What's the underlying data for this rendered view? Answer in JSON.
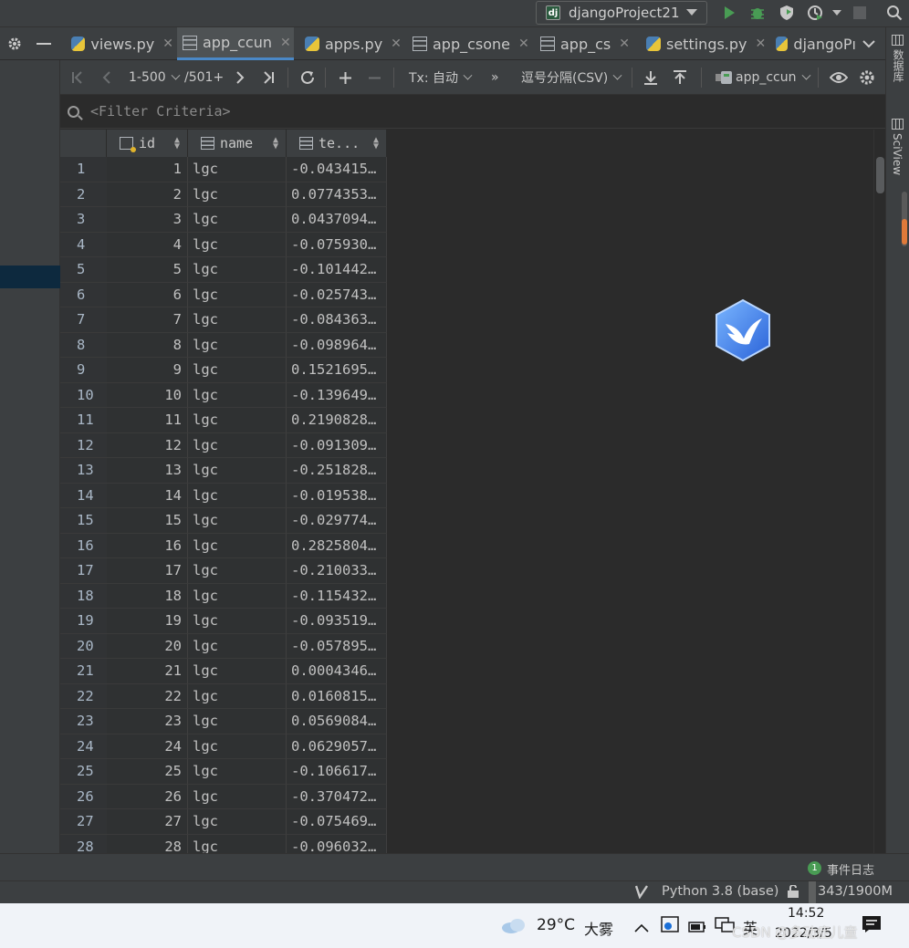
{
  "runbar": {
    "project_badge": "dj",
    "project_label": "djangoProject21"
  },
  "tabs": [
    {
      "label": "views.py",
      "icon": "python-file-icon",
      "active": false
    },
    {
      "label": "app_ccun",
      "icon": "table-icon",
      "active": true
    },
    {
      "label": "apps.py",
      "icon": "python-file-icon",
      "active": false
    },
    {
      "label": "app_csone",
      "icon": "table-icon",
      "active": false
    },
    {
      "label": "app_cs",
      "icon": "table-icon",
      "active": false
    },
    {
      "label": "settings.py",
      "icon": "python-file-icon",
      "active": false
    },
    {
      "label": "djangoPı",
      "icon": "python-file-icon",
      "active": false
    }
  ],
  "toolbar": {
    "page_range": "1-500",
    "total": "/501+",
    "tx_mode": "Tx: 自动",
    "more": "»",
    "export_format": "逗号分隔(CSV)",
    "datasource": "app_ccun"
  },
  "filter": {
    "placeholder": "<Filter Criteria>"
  },
  "table": {
    "columns": [
      {
        "label": "id",
        "icon": "primary-key-column-icon"
      },
      {
        "label": "name",
        "icon": "column-icon"
      },
      {
        "label": "te...",
        "icon": "column-icon"
      }
    ],
    "rows": [
      {
        "n": "1",
        "id": "1",
        "name": "lgc",
        "te": "-0.043415…"
      },
      {
        "n": "2",
        "id": "2",
        "name": "lgc",
        "te": "0.0774353…"
      },
      {
        "n": "3",
        "id": "3",
        "name": "lgc",
        "te": "0.0437094…"
      },
      {
        "n": "4",
        "id": "4",
        "name": "lgc",
        "te": "-0.075930…"
      },
      {
        "n": "5",
        "id": "5",
        "name": "lgc",
        "te": "-0.101442…"
      },
      {
        "n": "6",
        "id": "6",
        "name": "lgc",
        "te": "-0.025743…"
      },
      {
        "n": "7",
        "id": "7",
        "name": "lgc",
        "te": "-0.084363…"
      },
      {
        "n": "8",
        "id": "8",
        "name": "lgc",
        "te": "-0.098964…"
      },
      {
        "n": "9",
        "id": "9",
        "name": "lgc",
        "te": "0.1521695…"
      },
      {
        "n": "10",
        "id": "10",
        "name": "lgc",
        "te": "-0.139649…"
      },
      {
        "n": "11",
        "id": "11",
        "name": "lgc",
        "te": "0.2190828…"
      },
      {
        "n": "12",
        "id": "12",
        "name": "lgc",
        "te": "-0.091309…"
      },
      {
        "n": "13",
        "id": "13",
        "name": "lgc",
        "te": "-0.251828…"
      },
      {
        "n": "14",
        "id": "14",
        "name": "lgc",
        "te": "-0.019538…"
      },
      {
        "n": "15",
        "id": "15",
        "name": "lgc",
        "te": "-0.029774…"
      },
      {
        "n": "16",
        "id": "16",
        "name": "lgc",
        "te": "0.2825804…"
      },
      {
        "n": "17",
        "id": "17",
        "name": "lgc",
        "te": "-0.210033…"
      },
      {
        "n": "18",
        "id": "18",
        "name": "lgc",
        "te": "-0.115432…"
      },
      {
        "n": "19",
        "id": "19",
        "name": "lgc",
        "te": "-0.093519…"
      },
      {
        "n": "20",
        "id": "20",
        "name": "lgc",
        "te": "-0.057895…"
      },
      {
        "n": "21",
        "id": "21",
        "name": "lgc",
        "te": "0.0004346…"
      },
      {
        "n": "22",
        "id": "22",
        "name": "lgc",
        "te": "0.0160815…"
      },
      {
        "n": "23",
        "id": "23",
        "name": "lgc",
        "te": "0.0569084…"
      },
      {
        "n": "24",
        "id": "24",
        "name": "lgc",
        "te": "0.0629057…"
      },
      {
        "n": "25",
        "id": "25",
        "name": "lgc",
        "te": "-0.106617…"
      },
      {
        "n": "26",
        "id": "26",
        "name": "lgc",
        "te": "-0.370472…"
      },
      {
        "n": "27",
        "id": "27",
        "name": "lgc",
        "te": "-0.075469…"
      },
      {
        "n": "28",
        "id": "28",
        "name": "lgc",
        "te": "-0.096032…"
      }
    ]
  },
  "right_sidebar": {
    "database_label": "数据库",
    "sciview_label": "SciView"
  },
  "event_log": {
    "count": "1",
    "label": "事件日志"
  },
  "statusbar": {
    "interpreter": "Python 3.8 (base)",
    "memory": "343/1900M"
  },
  "taskbar": {
    "temperature": "29°C",
    "weather": "大雾",
    "ime": "英",
    "time": "14:52",
    "date": "2022/3/5",
    "watermark": "CSDN @多动症儿童"
  },
  "colors": {
    "accent": "#4a88c7",
    "editor_bg": "#2b2b2b",
    "panel_bg": "#3c3f41",
    "run_green": "#499c54",
    "selection": "#0d293e"
  }
}
